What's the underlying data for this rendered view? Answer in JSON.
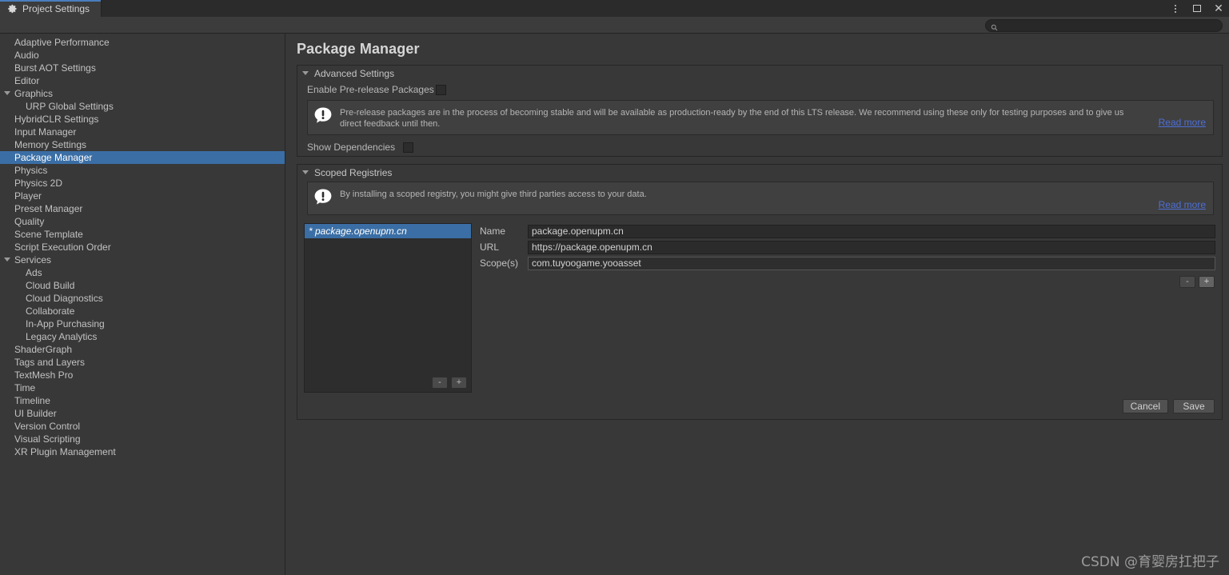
{
  "window": {
    "tab_label": "Project Settings",
    "tab_icon": "gear-icon",
    "controls": {
      "menu": "kebab-menu-icon",
      "maximize": "maximize-icon",
      "close": "close-icon"
    }
  },
  "search": {
    "value": "",
    "placeholder": "",
    "icon": "search-icon"
  },
  "sidebar": {
    "items": [
      {
        "label": "Adaptive Performance",
        "indent": false,
        "foldout": false,
        "selected": false
      },
      {
        "label": "Audio",
        "indent": false,
        "foldout": false,
        "selected": false
      },
      {
        "label": "Burst AOT Settings",
        "indent": false,
        "foldout": false,
        "selected": false
      },
      {
        "label": "Editor",
        "indent": false,
        "foldout": false,
        "selected": false
      },
      {
        "label": "Graphics",
        "indent": false,
        "foldout": true,
        "selected": false
      },
      {
        "label": "URP Global Settings",
        "indent": true,
        "foldout": false,
        "selected": false
      },
      {
        "label": "HybridCLR Settings",
        "indent": false,
        "foldout": false,
        "selected": false
      },
      {
        "label": "Input Manager",
        "indent": false,
        "foldout": false,
        "selected": false
      },
      {
        "label": "Memory Settings",
        "indent": false,
        "foldout": false,
        "selected": false
      },
      {
        "label": "Package Manager",
        "indent": false,
        "foldout": false,
        "selected": true
      },
      {
        "label": "Physics",
        "indent": false,
        "foldout": false,
        "selected": false
      },
      {
        "label": "Physics 2D",
        "indent": false,
        "foldout": false,
        "selected": false
      },
      {
        "label": "Player",
        "indent": false,
        "foldout": false,
        "selected": false
      },
      {
        "label": "Preset Manager",
        "indent": false,
        "foldout": false,
        "selected": false
      },
      {
        "label": "Quality",
        "indent": false,
        "foldout": false,
        "selected": false
      },
      {
        "label": "Scene Template",
        "indent": false,
        "foldout": false,
        "selected": false
      },
      {
        "label": "Script Execution Order",
        "indent": false,
        "foldout": false,
        "selected": false
      },
      {
        "label": "Services",
        "indent": false,
        "foldout": true,
        "selected": false
      },
      {
        "label": "Ads",
        "indent": true,
        "foldout": false,
        "selected": false
      },
      {
        "label": "Cloud Build",
        "indent": true,
        "foldout": false,
        "selected": false
      },
      {
        "label": "Cloud Diagnostics",
        "indent": true,
        "foldout": false,
        "selected": false
      },
      {
        "label": "Collaborate",
        "indent": true,
        "foldout": false,
        "selected": false
      },
      {
        "label": "In-App Purchasing",
        "indent": true,
        "foldout": false,
        "selected": false
      },
      {
        "label": "Legacy Analytics",
        "indent": true,
        "foldout": false,
        "selected": false
      },
      {
        "label": "ShaderGraph",
        "indent": false,
        "foldout": false,
        "selected": false
      },
      {
        "label": "Tags and Layers",
        "indent": false,
        "foldout": false,
        "selected": false
      },
      {
        "label": "TextMesh Pro",
        "indent": false,
        "foldout": false,
        "selected": false
      },
      {
        "label": "Time",
        "indent": false,
        "foldout": false,
        "selected": false
      },
      {
        "label": "Timeline",
        "indent": false,
        "foldout": false,
        "selected": false
      },
      {
        "label": "UI Builder",
        "indent": false,
        "foldout": false,
        "selected": false
      },
      {
        "label": "Version Control",
        "indent": false,
        "foldout": false,
        "selected": false
      },
      {
        "label": "Visual Scripting",
        "indent": false,
        "foldout": false,
        "selected": false
      },
      {
        "label": "XR Plugin Management",
        "indent": false,
        "foldout": false,
        "selected": false
      }
    ]
  },
  "main": {
    "title": "Package Manager",
    "advanced_settings": {
      "header": "Advanced Settings",
      "enable_prerelease_label": "Enable Pre-release Packages",
      "enable_prerelease_checked": false,
      "warning_text": "Pre-release packages are in the process of becoming stable and will be available as production-ready by the end of this LTS release. We recommend using these only for testing purposes and to give us direct feedback until then.",
      "warning_link": "Read more",
      "warning_icon": "info-exclamation-icon",
      "show_dependencies_label": "Show Dependencies",
      "show_dependencies_checked": false
    },
    "scoped_registries": {
      "header": "Scoped Registries",
      "warning_text": "By installing a scoped registry, you might give third parties access to your data.",
      "warning_link": "Read more",
      "warning_icon": "info-exclamation-icon",
      "list": [
        {
          "label": "* package.openupm.cn",
          "selected": true
        }
      ],
      "list_remove_label": "-",
      "list_add_label": "+",
      "fields": {
        "name_label": "Name",
        "name_value": "package.openupm.cn",
        "url_label": "URL",
        "url_value": "https://package.openupm.cn",
        "scopes_label": "Scope(s)",
        "scopes_value": "com.tuyoogame.yooasset"
      },
      "scope_remove_label": "-",
      "scope_add_label": "+",
      "cancel_label": "Cancel",
      "save_label": "Save"
    }
  },
  "watermark": "CSDN @育婴房扛把子",
  "colors": {
    "accent_blue": "#3a6ea5",
    "tab_accent": "#4a7dbd",
    "link_blue": "#4d6fd6",
    "panel_bg": "#383838",
    "field_bg": "#2b2b2b"
  }
}
